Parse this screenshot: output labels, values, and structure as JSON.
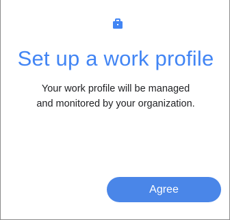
{
  "header": {
    "icon": "briefcase-icon",
    "title": "Set up a work profile"
  },
  "body": {
    "description_line1": "Your work profile will be managed",
    "description_line2": "and monitored by your organization."
  },
  "actions": {
    "agree_label": "Agree"
  },
  "colors": {
    "accent": "#4285f4",
    "button": "#4a86e8",
    "text": "#202124"
  }
}
